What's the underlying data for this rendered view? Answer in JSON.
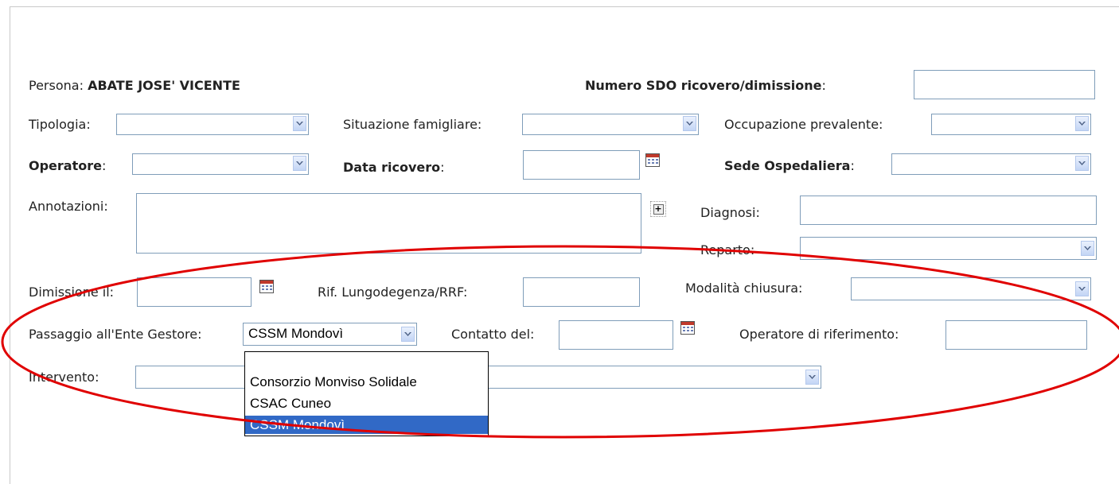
{
  "persona": {
    "label": "Persona:",
    "name": "ABATE JOSE' VICENTE"
  },
  "sdo": {
    "label": "Numero SDO ricovero/dimissione",
    "colon": ":",
    "value": ""
  },
  "row2": {
    "tipologia": {
      "label": "Tipologia:",
      "value": ""
    },
    "situazione": {
      "label": "Situazione famigliare:",
      "value": ""
    },
    "occupazione": {
      "label": "Occupazione prevalente:",
      "value": ""
    }
  },
  "row3": {
    "operatore": {
      "label": "Operatore",
      "colon": ":",
      "value": ""
    },
    "data_ricovero": {
      "label": "Data ricovero",
      "colon": ":",
      "value": ""
    },
    "sede": {
      "label": "Sede Ospedaliera",
      "colon": ":",
      "value": ""
    }
  },
  "annotazioni": {
    "label": "Annotazioni:",
    "value": ""
  },
  "diagnosi": {
    "label": "Diagnosi:",
    "value": ""
  },
  "reparto": {
    "label": "Reparto:",
    "value": ""
  },
  "row_dimissione": {
    "dimissione": {
      "label": "Dimissione il:",
      "value": ""
    },
    "rif": {
      "label": "Rif. Lungodegenza/RRF:",
      "value": ""
    },
    "modalita": {
      "label": "Modalità chiusura:",
      "value": ""
    }
  },
  "row_passaggio": {
    "passaggio": {
      "label": "Passaggio all'Ente Gestore:",
      "value": "CSSM Mondovì"
    },
    "contatto": {
      "label": "Contatto del:",
      "value": ""
    },
    "operatore_rif": {
      "label": "Operatore di riferimento:",
      "value": ""
    }
  },
  "intervento": {
    "label": "Intervento:",
    "value": ""
  },
  "dropdown_options": [
    "",
    "Consorzio Monviso Solidale",
    "CSAC Cuneo",
    "CSSM Mondovì"
  ],
  "colors": {
    "highlight": "#3169c6",
    "annotation_oval": "#e00000",
    "field_border": "#7f9db9"
  }
}
